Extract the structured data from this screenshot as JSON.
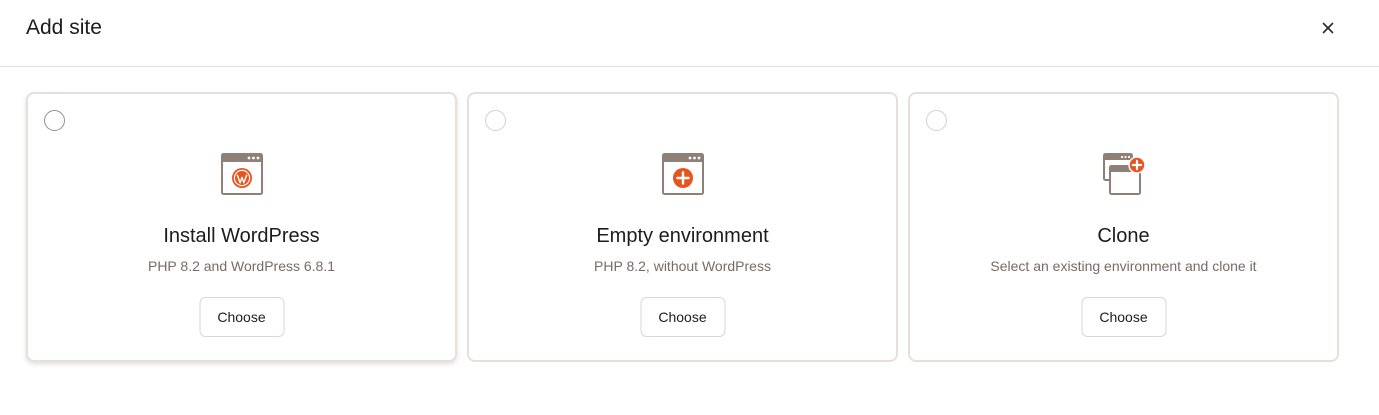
{
  "dialog": {
    "title": "Add site",
    "close_icon": "close-icon"
  },
  "colors": {
    "accent": "#e8541f",
    "icon_frame": "#8f7f79",
    "card_border": "#e6e0da",
    "subtitle": "#7b6a64"
  },
  "cards": [
    {
      "title": "Install WordPress",
      "subtitle": "PHP 8.2 and WordPress 6.8.1",
      "button_label": "Choose",
      "icon": "wordpress-window-icon",
      "selected": false
    },
    {
      "title": "Empty environment",
      "subtitle": "PHP 8.2, without WordPress",
      "button_label": "Choose",
      "icon": "add-window-icon",
      "selected": false
    },
    {
      "title": "Clone",
      "subtitle": "Select an existing environment and clone it",
      "button_label": "Choose",
      "icon": "clone-window-icon",
      "selected": false
    }
  ]
}
